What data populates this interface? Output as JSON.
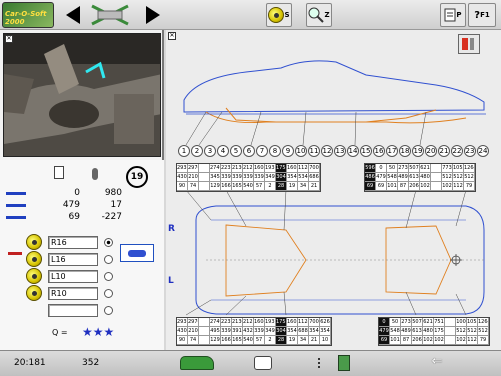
{
  "toolbar": {
    "logo_text": "Car-O-Soft 2000",
    "zoom_s_label": "S",
    "zoom_z_label": "Z",
    "p_label": "P",
    "f1_label": "F1",
    "icons": [
      "back-arrow-icon",
      "measure-icon",
      "forward-arrow-icon",
      "zoom-s-icon",
      "zoom-z-icon",
      "print-icon",
      "help-icon"
    ]
  },
  "left_panel": {
    "badge_number": "19",
    "values": [
      {
        "a": "0",
        "b": "980"
      },
      {
        "a": "479",
        "b": "17"
      },
      {
        "a": "69",
        "b": "-227"
      }
    ],
    "points": [
      {
        "label": "R16",
        "selected": true
      },
      {
        "label": "L16",
        "selected": false
      },
      {
        "label": "L10",
        "selected": false
      },
      {
        "label": "R10",
        "selected": false
      },
      {
        "label": "",
        "selected": false
      }
    ],
    "quality_label": "Q =",
    "quality_stars": "★★★"
  },
  "diagram": {
    "point_numbers": [
      "1",
      "2",
      "3",
      "4",
      "5",
      "6",
      "7",
      "8",
      "9",
      "10",
      "11",
      "12",
      "13",
      "14",
      "15",
      "16",
      "17",
      "18",
      "19",
      "20",
      "21",
      "22",
      "23",
      "24"
    ],
    "side_r": "R",
    "side_l": "L",
    "top_table_left": [
      [
        "2937",
        "2976",
        "",
        "2749",
        "2237",
        "2130",
        "2121",
        "1608",
        "1937",
        "1751",
        "1603",
        "1128",
        "700"
      ],
      [
        "430",
        "210",
        "",
        "345",
        "339",
        "339",
        "339",
        "339",
        "349",
        "304",
        "354",
        "534",
        "686"
      ],
      [
        "90",
        "74",
        "",
        "129",
        "166",
        "165",
        "540",
        "57",
        "2",
        "28",
        "19",
        "34",
        "21"
      ]
    ],
    "top_table_right": [
      [
        "596",
        "0",
        "50",
        "273",
        "507",
        "621",
        "",
        "773",
        "1053",
        "1264"
      ],
      [
        "486",
        "479",
        "548",
        "489",
        "613",
        "480",
        "",
        "512",
        "512",
        "512"
      ],
      [
        "69",
        "69",
        "101",
        "87",
        "206",
        "102",
        "",
        "102",
        "112",
        "79"
      ]
    ],
    "bottom_table_left": [
      [
        "2937",
        "2976",
        "",
        "2749",
        "2237",
        "2130",
        "2121",
        "1608",
        "1937",
        "1751",
        "1603",
        "1128",
        "700",
        "626"
      ],
      [
        "430",
        "210",
        "",
        "495",
        "339",
        "391",
        "432",
        "339",
        "349",
        "304",
        "354",
        "688",
        "354",
        "354"
      ],
      [
        "90",
        "74",
        "",
        "129",
        "166",
        "165",
        "540",
        "57",
        "2",
        "28",
        "19",
        "34",
        "21",
        "10"
      ]
    ],
    "bottom_table_right": [
      [
        "0",
        "50",
        "273",
        "507",
        "621",
        "751",
        "",
        "100",
        "1053",
        "1264"
      ],
      [
        "479",
        "548",
        "489",
        "613",
        "480",
        "175",
        "",
        "512",
        "512",
        "512"
      ],
      [
        "69",
        "101",
        "87",
        "206",
        "102",
        "102",
        "",
        "102",
        "112",
        "79"
      ]
    ]
  },
  "status": {
    "left_value": "20:181",
    "right_value": "352"
  },
  "colors": {
    "accent_blue": "#2030c0",
    "orange": "#e08020",
    "yellow": "#e6d800"
  }
}
